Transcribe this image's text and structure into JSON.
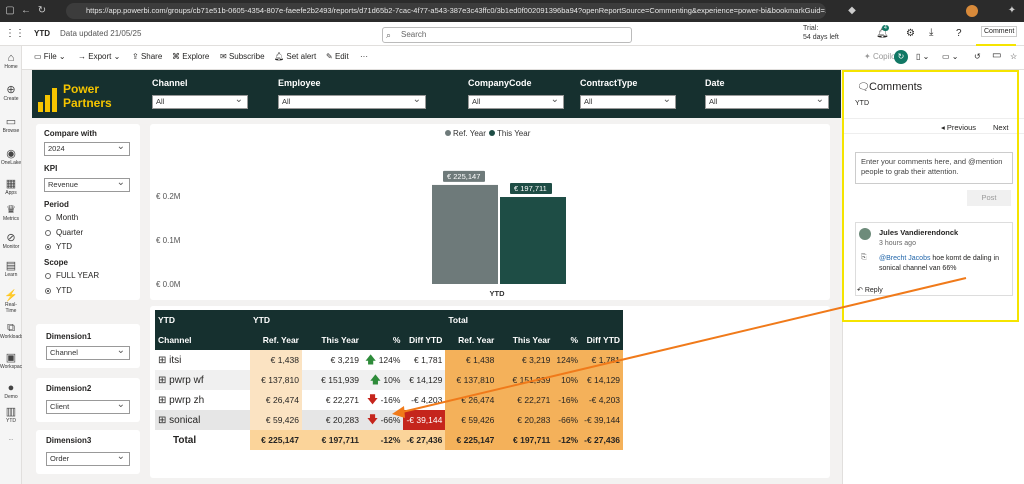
{
  "browser": {
    "url": "https://app.powerbi.com/groups/cb71e51b-0605-4354-807e-faeefe2b2493/reports/d71d65b2-7cac-4f77-a543-387e3c43ffc0/3b1ed0f002091396ba94?openReportSource=Commenting&experience=power-bi&bookmarkGuid=..."
  },
  "header": {
    "report_name": "YTD",
    "data_updated": "Data updated 21/05/25",
    "search_placeholder": "Search",
    "trial_line1": "Trial:",
    "trial_line2": "54 days left",
    "notif_count": "4",
    "comment_tooltip": "Comment"
  },
  "toolbar": {
    "file": "File",
    "export": "Export",
    "share": "Share",
    "explore": "Explore",
    "subscribe": "Subscribe",
    "set_alert": "Set alert",
    "edit": "Edit",
    "more": "···",
    "copilot": "Copilot"
  },
  "nav": [
    {
      "label": "Home",
      "icon": "⌂"
    },
    {
      "label": "Create",
      "icon": "⊕"
    },
    {
      "label": "Browse",
      "icon": "▭"
    },
    {
      "label": "OneLake",
      "icon": "◉"
    },
    {
      "label": "Apps",
      "icon": "▦"
    },
    {
      "label": "Metrics",
      "icon": "♛"
    },
    {
      "label": "Monitor",
      "icon": "⊘"
    },
    {
      "label": "Learn",
      "icon": "▤"
    },
    {
      "label": "Real-Time",
      "icon": "⚡"
    },
    {
      "label": "Workloads",
      "icon": "⧉"
    },
    {
      "label": "Workspaces",
      "icon": "▣"
    },
    {
      "label": "Demo",
      "icon": "●"
    },
    {
      "label": "YTD",
      "icon": "▥"
    },
    {
      "label": "...",
      "icon": ""
    }
  ],
  "logo": {
    "line1": "Power",
    "line2": "Partners"
  },
  "slicers": [
    {
      "title": "Channel",
      "value": "All"
    },
    {
      "title": "Employee",
      "value": "All"
    },
    {
      "title": "CompanyCode",
      "value": "All"
    },
    {
      "title": "ContractType",
      "value": "All"
    },
    {
      "title": "Date",
      "value": "All"
    }
  ],
  "left": {
    "compare_title": "Compare with",
    "compare_value": "2024",
    "kpi_title": "KPI",
    "kpi_value": "Revenue",
    "period_title": "Period",
    "period_opts": [
      "Month",
      "Quarter",
      "YTD"
    ],
    "scope_title": "Scope",
    "scope_opts": [
      "FULL YEAR",
      "YTD"
    ],
    "dim1_title": "Dimension1",
    "dim1_value": "Channel",
    "dim2_title": "Dimension2",
    "dim2_value": "Client",
    "dim3_title": "Dimension3",
    "dim3_value": "Order"
  },
  "chart_data": {
    "type": "bar",
    "categories": [
      "YTD"
    ],
    "series": [
      {
        "name": "Ref. Year",
        "values": [
          225147
        ],
        "color": "#6e7a7a"
      },
      {
        "name": "This Year",
        "values": [
          197711
        ],
        "color": "#1e4d45"
      }
    ],
    "data_labels": [
      "€ 225,147",
      "€ 197,711"
    ],
    "y_ticks": [
      "€ 0.0M",
      "€ 0.1M",
      "€ 0.2M"
    ],
    "ylim": [
      0,
      250000
    ],
    "legend_position": "top-center"
  },
  "table": {
    "group1": "YTD",
    "group2": "Total",
    "corner": "YTD",
    "headers": [
      "Channel",
      "Ref. Year",
      "This Year",
      "%",
      "Diff YTD",
      "Ref. Year",
      "This Year",
      "%",
      "Diff YTD"
    ],
    "rows": [
      {
        "name": "itsi",
        "ref": "€ 1,438",
        "this": "€ 3,219",
        "pct": "124%",
        "diff": "€ 1,781",
        "tref": "€ 1,438",
        "tthis": "€ 3,219",
        "tpct": "124%",
        "tdiff": "€ 1,781",
        "dir": "up"
      },
      {
        "name": "pwrp wf",
        "ref": "€ 137,810",
        "this": "€ 151,939",
        "pct": "10%",
        "diff": "€ 14,129",
        "tref": "€ 137,810",
        "tthis": "€ 151,939",
        "tpct": "10%",
        "tdiff": "€ 14,129",
        "dir": "up"
      },
      {
        "name": "pwrp zh",
        "ref": "€ 26,474",
        "this": "€ 22,271",
        "pct": "-16%",
        "diff": "-€ 4,203",
        "tref": "€ 26,474",
        "tthis": "€ 22,271",
        "tpct": "-16%",
        "tdiff": "-€ 4,203",
        "dir": "down"
      },
      {
        "name": "sonical",
        "ref": "€ 59,426",
        "this": "€ 20,283",
        "pct": "-66%",
        "diff": "-€ 39,144",
        "tref": "€ 59,426",
        "tthis": "€ 20,283",
        "tpct": "-66%",
        "tdiff": "-€ 39,144",
        "dir": "down"
      }
    ],
    "total": {
      "name": "Total",
      "ref": "€ 225,147",
      "this": "€ 197,711",
      "pct": "-12%",
      "diff": "-€ 27,436",
      "tref": "€ 225,147",
      "tthis": "€ 197,711",
      "tpct": "-12%",
      "tdiff": "-€ 27,436"
    }
  },
  "comments": {
    "title": "Comments",
    "context": "YTD",
    "previous": "Previous",
    "next": "Next",
    "placeholder": "Enter your comments here, and @mention people to grab their attention.",
    "post": "Post",
    "author": "Jules Vandierendonck",
    "time": "3 hours ago",
    "mention": "@Brecht Jacobs",
    "text": " hoe komt de daling in sonical channel van 66%",
    "reply": "Reply"
  },
  "colors": {
    "dark": "#16302f",
    "gold": "#f5c400",
    "orange": "#f4b15a",
    "light_orange": "#fbd49a",
    "red": "#c5251c",
    "arrow": "#f07a1a"
  }
}
